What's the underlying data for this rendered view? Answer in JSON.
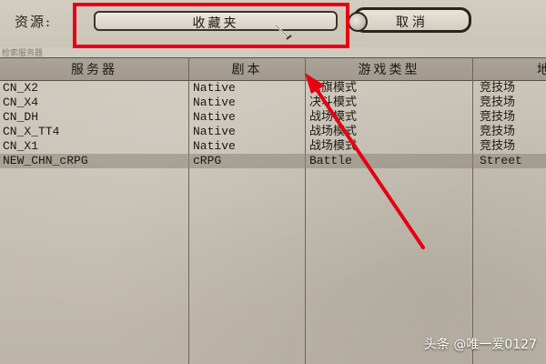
{
  "toolbar": {
    "source_label": "资源:",
    "source_selected": "收藏夹",
    "cancel_label": "取消",
    "search_note": "检索服务器"
  },
  "table": {
    "columns": [
      "服务器",
      "剧本",
      "游戏类型",
      "地"
    ],
    "rows": [
      {
        "server": "CN_X2",
        "script": "Native",
        "type": "抢旗模式",
        "map": "竞技场"
      },
      {
        "server": "CN_X4",
        "script": "Native",
        "type": "决斗模式",
        "map": "竞技场"
      },
      {
        "server": "CN_DH",
        "script": "Native",
        "type": "战场模式",
        "map": "竞技场"
      },
      {
        "server": "CN_X_TT4",
        "script": "Native",
        "type": "战场模式",
        "map": "竞技场"
      },
      {
        "server": "CN_X1",
        "script": "Native",
        "type": "战场模式",
        "map": "竞技场"
      },
      {
        "server": "NEW_CHN_cRPG",
        "script": "cRPG",
        "type": "Battle",
        "map": "Street"
      }
    ]
  },
  "annotation": {
    "highlight_color": "#e60012"
  },
  "watermark": "头条 @唯一爱0127"
}
